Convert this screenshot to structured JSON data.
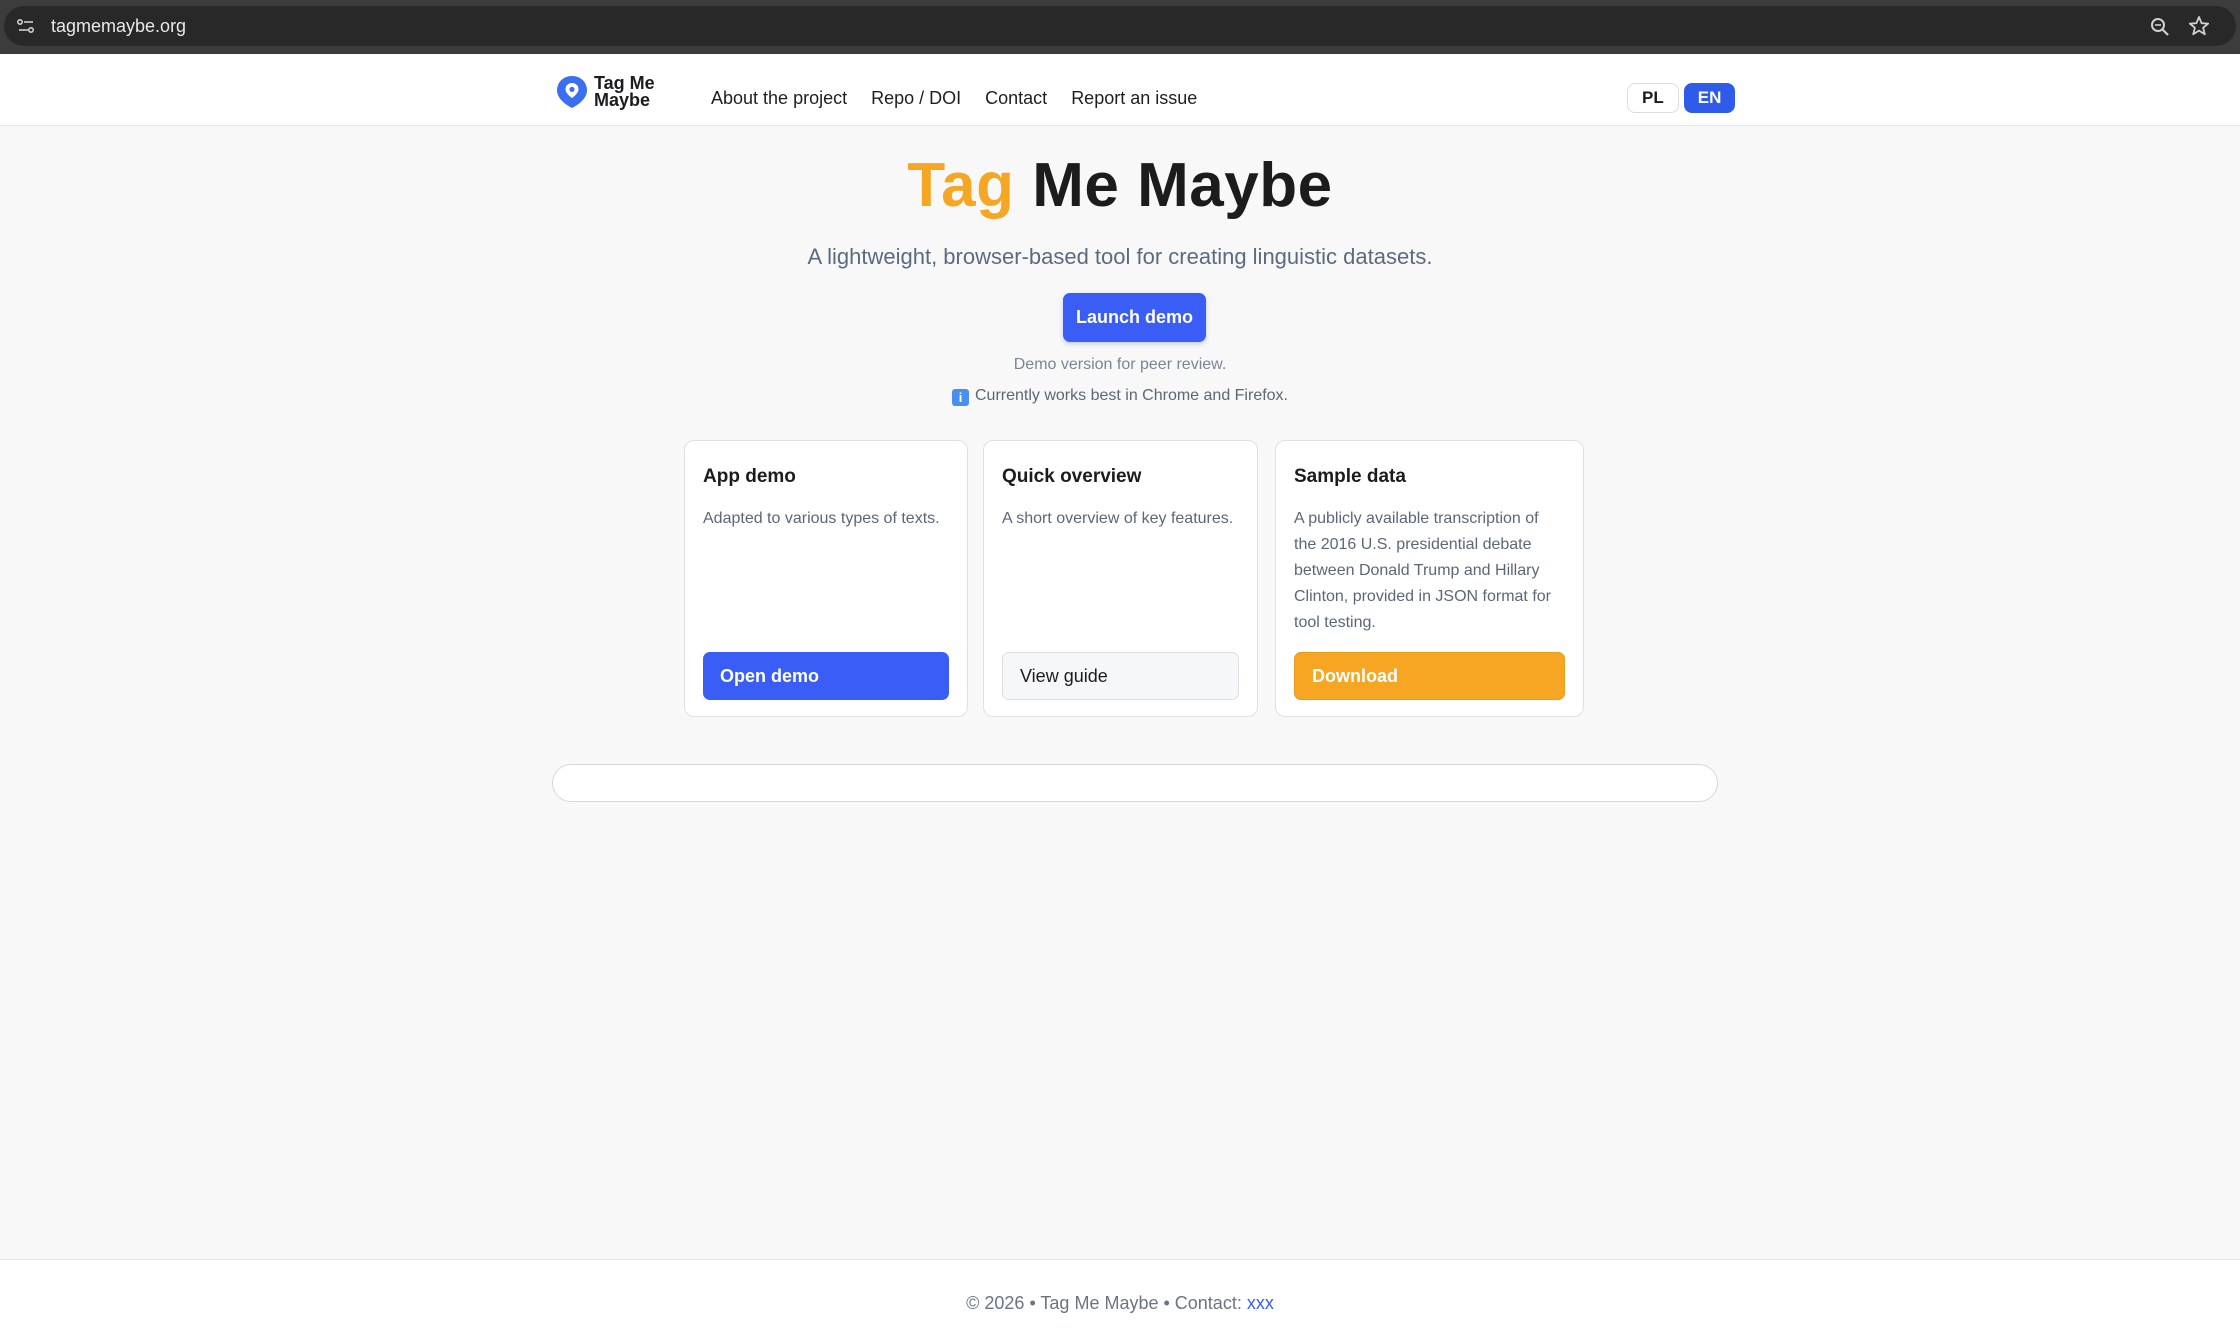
{
  "browser": {
    "url": "tagmemaybe.org",
    "icons": [
      "site-info-icon",
      "zoom-icon",
      "bookmark-star-icon"
    ]
  },
  "header": {
    "logo_text": "Tag Me Maybe",
    "nav": [
      {
        "label": "About the project"
      },
      {
        "label": "Repo / DOI"
      },
      {
        "label": "Contact"
      },
      {
        "label": "Report an issue"
      }
    ],
    "lang": {
      "pl": "PL",
      "en": "EN",
      "active": "EN"
    }
  },
  "hero": {
    "title_accent": "Tag",
    "title_rest": "Me Maybe",
    "subtitle": "A lightweight, browser-based tool for creating linguistic datasets.",
    "launch_label": "Launch demo",
    "note_review": "Demo version for peer review.",
    "note_browser": "Currently works best in Chrome and Firefox.",
    "info_icon_glyph": "i"
  },
  "cards": [
    {
      "title": "App demo",
      "text": "Adapted to various types of texts.",
      "button": "Open demo"
    },
    {
      "title": "Quick overview",
      "text": "A short overview of key features.",
      "button": "View guide"
    },
    {
      "title": "Sample data",
      "text": "A publicly available transcription of the 2016 U.S. presidential debate between Donald Trump and Hillary Clinton, provided in JSON format for tool testing.",
      "button": "Download"
    }
  ],
  "footer": {
    "text": "© 2026 • Tag Me Maybe • Contact:",
    "contact_link": "xxx"
  },
  "colors": {
    "accent_blue": "#3a5df5",
    "accent_orange": "#f5a623",
    "lang_active": "#2f5bea"
  }
}
